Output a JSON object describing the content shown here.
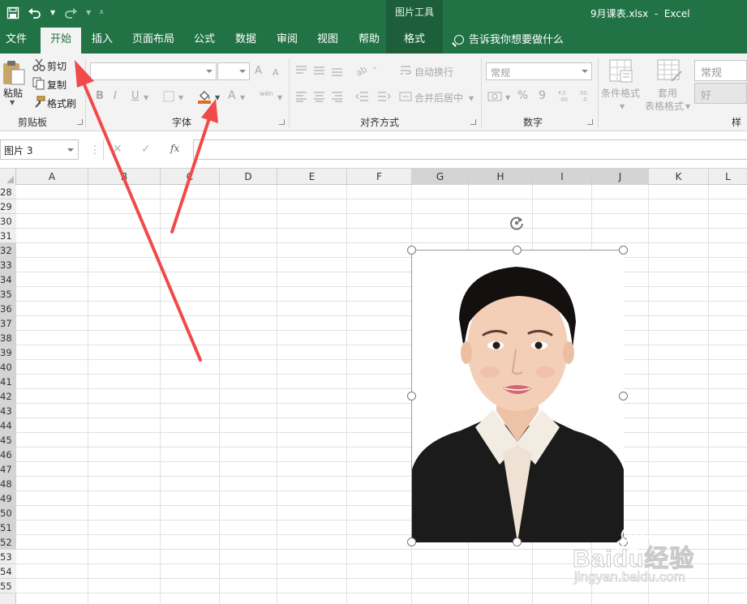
{
  "window": {
    "title": "9月课表.xlsx  -  Excel",
    "context_tools": "图片工具"
  },
  "tabs": [
    {
      "label": "文件",
      "left": 0
    },
    {
      "label": "开始"
    },
    {
      "label": "插入"
    },
    {
      "label": "页面布局"
    },
    {
      "label": "公式"
    },
    {
      "label": "数据"
    },
    {
      "label": "审阅"
    },
    {
      "label": "视图"
    },
    {
      "label": "帮助"
    },
    {
      "label": "格式"
    }
  ],
  "tell_me": "告诉我你想要做什么",
  "clipboard": {
    "paste": "粘贴",
    "cut": "剪切",
    "copy": "复制",
    "format_painter": "格式刷",
    "label": "剪贴板"
  },
  "font": {
    "label": "字体",
    "bold": "B",
    "italic": "I",
    "underline": "U",
    "grow": "A",
    "shrink": "A",
    "font_color": "A",
    "phonetic": "wén"
  },
  "alignment": {
    "label": "对齐方式",
    "wrap": "自动换行",
    "merge": "合并后居中"
  },
  "number": {
    "label": "数字",
    "format": "常规",
    "percent": "%",
    "comma": "9"
  },
  "styles": {
    "conditional": "条件格式",
    "table_format": "套用",
    "table_format2": "表格格式",
    "style_normal": "常规",
    "style_good": "好",
    "label": "样式"
  },
  "formula_bar": {
    "name_box": "图片 3",
    "fx": "fx"
  },
  "columns": [
    "A",
    "B",
    "C",
    "D",
    "E",
    "F",
    "G",
    "H",
    "I",
    "J",
    "K",
    "L"
  ],
  "rows": [
    "28",
    "29",
    "30",
    "31",
    "32",
    "33",
    "34",
    "35",
    "36",
    "37",
    "38",
    "39",
    "40",
    "41",
    "42",
    "43",
    "44",
    "45",
    "46",
    "47",
    "48",
    "49",
    "50",
    "51",
    "52",
    "53",
    "54",
    "55"
  ],
  "watermark": {
    "brand": "Baidu经验",
    "url": "jingyan.baidu.com"
  },
  "colors": {
    "accent": "#217346",
    "arrow": "#f04a4a",
    "fill_color": "#e06c1c"
  }
}
